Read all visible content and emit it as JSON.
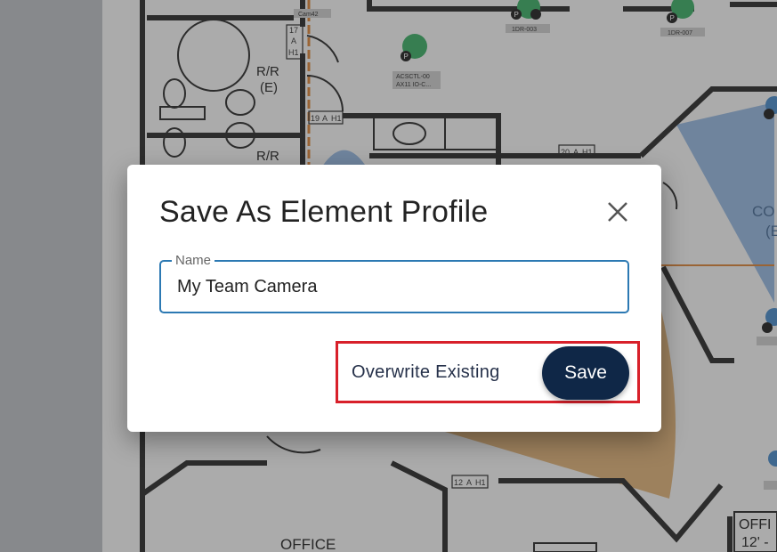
{
  "floorplan": {
    "rooms": {
      "restroom_1": "R/R",
      "restroom_1_sub": "(E)",
      "restroom_2": "R/R",
      "office_bottom": "OFFICE",
      "office_right": "OFFI",
      "office_right_dim": "12' -",
      "corridor_right": "CO",
      "corridor_right_sub": "(E"
    },
    "device_tags": {
      "cam42": "Cam42",
      "idr003": "1DR-003",
      "idr007": "1DR-007",
      "acs_line1": "ACSCTL-00",
      "acs_line2": "AX11 IO-C..."
    },
    "pins": {
      "pin_marker": "P"
    },
    "door_tags": {
      "d17_top": "17",
      "d17_mid": "A",
      "d17_bot": "H1",
      "d19_a": "19",
      "d19_b": "A",
      "d19_c": "H1",
      "d20_a": "20",
      "d20_b": "A",
      "d20_c": "H1",
      "d12_a": "12",
      "d12_b": "A",
      "d12_c": "H1"
    },
    "colors": {
      "wall": "#1b1b1b",
      "camera_fov_blue": "#7aa6d8",
      "camera_fov_tan": "#d9a55f",
      "device_green": "#2ea85a",
      "conduit_orange": "#d77a2a"
    }
  },
  "dialog": {
    "title": "Save As Element Profile",
    "close_icon": "close-icon",
    "name_field": {
      "label": "Name",
      "value": "My Team Camera"
    },
    "actions": {
      "overwrite_label": "Overwrite Existing",
      "save_label": "Save"
    },
    "colors": {
      "field_border": "#2c79b3",
      "save_bg": "#0f2747",
      "highlight": "#d8202a"
    }
  }
}
